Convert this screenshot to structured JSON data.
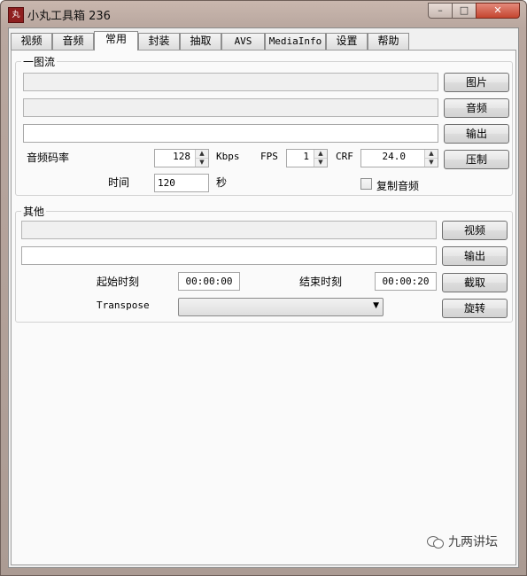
{
  "window": {
    "title": "小丸工具箱 236",
    "app_icon_text": "丸",
    "controls": {
      "minimize": "–",
      "maximize": "□",
      "close": "✕"
    }
  },
  "tabs": [
    {
      "label": "视频",
      "active": false
    },
    {
      "label": "音频",
      "active": false
    },
    {
      "label": "常用",
      "active": true
    },
    {
      "label": "封装",
      "active": false
    },
    {
      "label": "抽取",
      "active": false
    },
    {
      "label": "AVS",
      "active": false
    },
    {
      "label": "MediaInfo",
      "active": false
    },
    {
      "label": "设置",
      "active": false
    },
    {
      "label": "帮助",
      "active": false
    }
  ],
  "group1": {
    "title": "一图流",
    "image_button": "图片",
    "audio_button": "音频",
    "output_button": "输出",
    "encode_button": "压制",
    "audio_bitrate_label": "音频码率",
    "audio_bitrate_value": "128",
    "kbps_label": "Kbps",
    "fps_label": "FPS",
    "fps_value": "1",
    "crf_label": "CRF",
    "crf_value": "24.0",
    "time_label": "时间",
    "time_value": "120",
    "seconds_label": "秒",
    "copy_audio_label": "复制音频",
    "copy_audio_checked": false
  },
  "group2": {
    "title": "其他",
    "video_button": "视频",
    "output_button": "输出",
    "start_label": "起始时刻",
    "start_value": "00:00:00",
    "end_label": "结束时刻",
    "end_value": "00:00:20",
    "cut_button": "截取",
    "transpose_label": "Transpose",
    "transpose_value": "",
    "rotate_button": "旋转"
  },
  "watermark": {
    "text": "九两讲坛"
  }
}
